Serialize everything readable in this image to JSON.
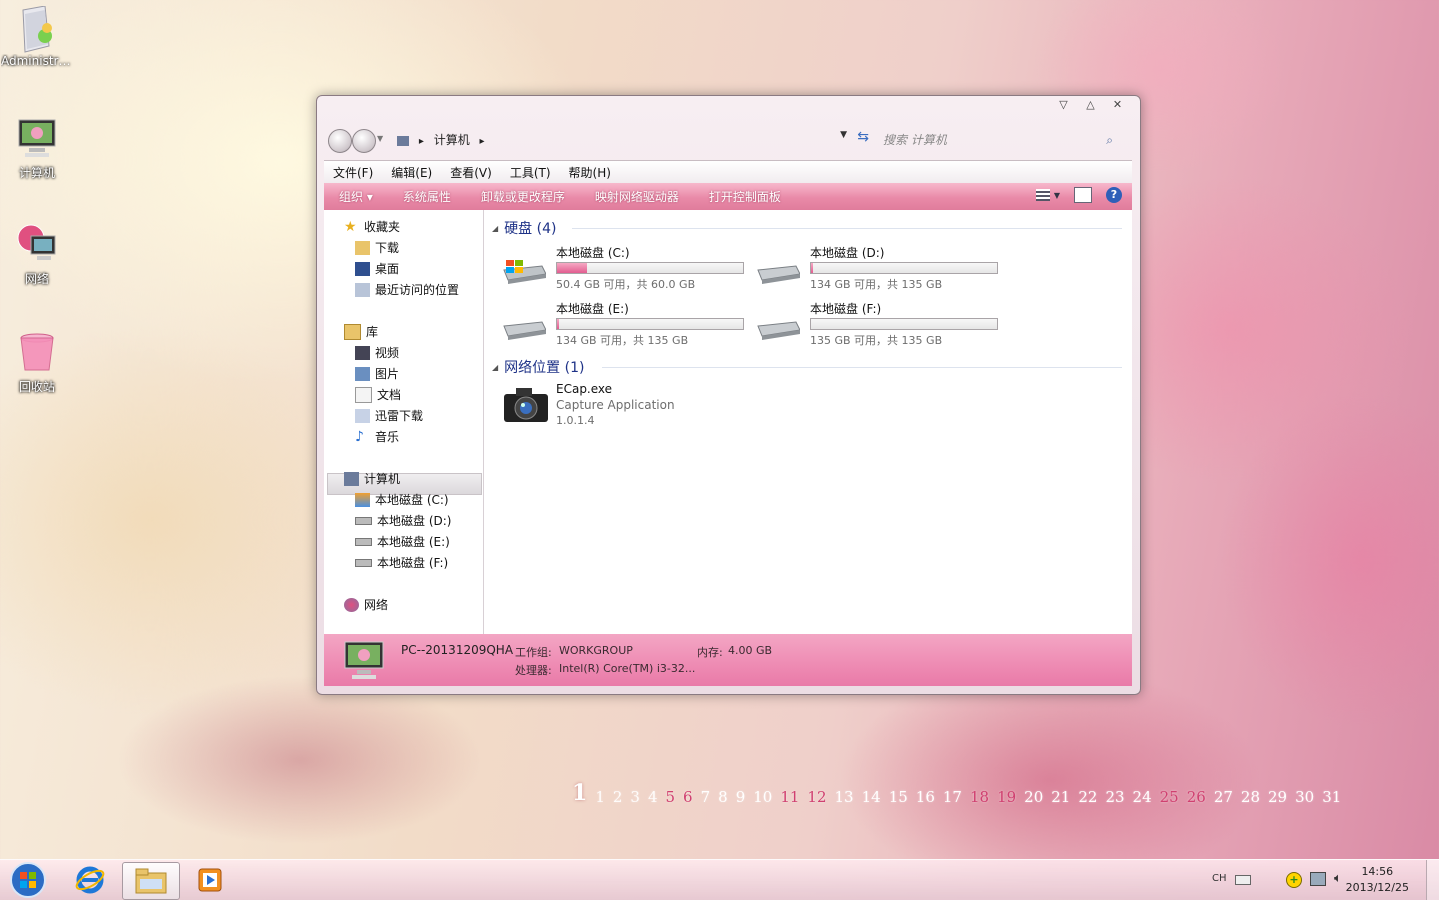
{
  "desktop": {
    "icons": [
      {
        "label": "Administra..."
      },
      {
        "label": "计算机"
      },
      {
        "label": "网络"
      },
      {
        "label": "回收站"
      }
    ]
  },
  "window": {
    "address": {
      "crumb": "计算机",
      "arrow": "▸"
    },
    "search_placeholder": "搜索 计算机",
    "menu": [
      "文件(F)",
      "编辑(E)",
      "查看(V)",
      "工具(T)",
      "帮助(H)"
    ],
    "commands": [
      "组织 ▾",
      "系统属性",
      "卸载或更改程序",
      "映射网络驱动器",
      "打开控制面板"
    ],
    "nav": {
      "favorites": {
        "label": "收藏夹",
        "items": [
          "下载",
          "桌面",
          "最近访问的位置"
        ]
      },
      "libraries": {
        "label": "库",
        "items": [
          "视频",
          "图片",
          "文档",
          "迅雷下载",
          "音乐"
        ]
      },
      "computer": {
        "label": "计算机",
        "items": [
          "本地磁盘 (C:)",
          "本地磁盘 (D:)",
          "本地磁盘 (E:)",
          "本地磁盘 (F:)"
        ]
      },
      "network": {
        "label": "网络"
      }
    },
    "groups": {
      "hdd": {
        "title": "硬盘 (4)"
      },
      "network": {
        "title": "网络位置 (1)"
      }
    },
    "drives": [
      {
        "name": "本地磁盘 (C:)",
        "info": "50.4 GB 可用，共 60.0 GB",
        "used_fraction": 0.16
      },
      {
        "name": "本地磁盘 (D:)",
        "info": "134 GB 可用，共 135 GB",
        "used_fraction": 0.01
      },
      {
        "name": "本地磁盘 (E:)",
        "info": "134 GB 可用，共 135 GB",
        "used_fraction": 0.01
      },
      {
        "name": "本地磁盘 (F:)",
        "info": "135 GB 可用，共 135 GB",
        "used_fraction": 0.0
      }
    ],
    "network_item": {
      "name": "ECap.exe",
      "desc": "Capture Application",
      "version": "1.0.1.4"
    },
    "details": {
      "pc_name": "PC--20131209QHA",
      "workgroup_label": "工作组:",
      "workgroup": "WORKGROUP",
      "memory_label": "内存:",
      "memory": "4.00 GB",
      "cpu_label": "处理器:",
      "cpu": "Intel(R) Core(TM) i3-32..."
    }
  },
  "calendar": {
    "days": [
      "1",
      "1",
      "2",
      "3",
      "4",
      "5",
      "6",
      "7",
      "8",
      "9",
      "10",
      "11",
      "12",
      "13",
      "14",
      "15",
      "16",
      "17",
      "18",
      "19",
      "20",
      "21",
      "22",
      "23",
      "24",
      "25",
      "26",
      "27",
      "28",
      "29",
      "30",
      "31"
    ]
  },
  "taskbar": {
    "lang": "CH",
    "time": "14:56",
    "date": "2013/12/25"
  },
  "colors": {
    "accent": "#e98aa8",
    "link_blue": "#1e3287",
    "drive_fill": "#e25d90"
  }
}
